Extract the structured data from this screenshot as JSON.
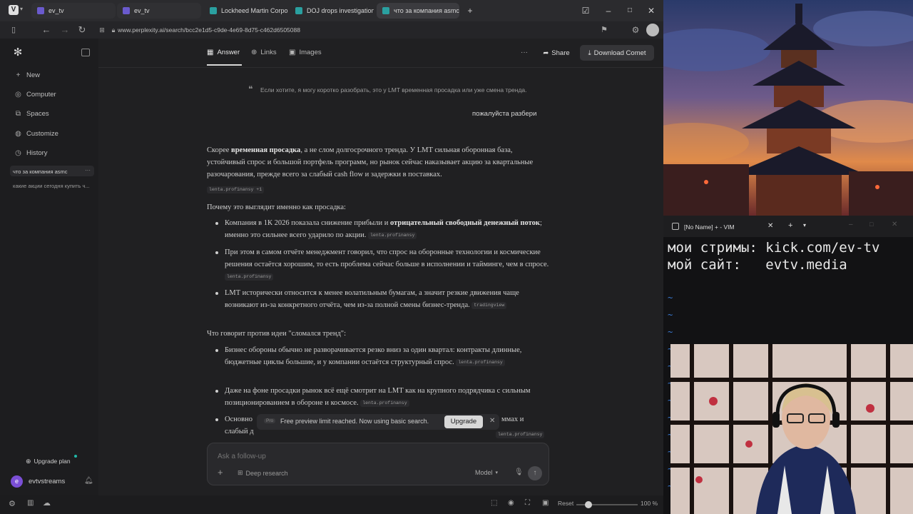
{
  "tabs": [
    {
      "label": "ev_tv",
      "color": "#6a5acd"
    },
    {
      "label": "ev_tv",
      "color": "#6a5acd"
    },
    {
      "label": "Lockheed Martin Corporat",
      "color": "#2aa0a0"
    },
    {
      "label": "DOJ drops investigation of",
      "color": "#2aa0a0"
    },
    {
      "label": "что за компания asmc",
      "color": "#2aa0a0"
    }
  ],
  "url": "www.perplexity.ai/search/bcc2e1d5-c9de-4e69-8d75-c462d6505088",
  "sidebar": {
    "items": [
      {
        "label": "New",
        "icon": "plus-icon"
      },
      {
        "label": "Computer",
        "icon": "computer-icon"
      },
      {
        "label": "Spaces",
        "icon": "spaces-icon"
      },
      {
        "label": "Customize",
        "icon": "customize-icon"
      },
      {
        "label": "History",
        "icon": "history-icon"
      }
    ],
    "threads": [
      "что за компания asmc",
      "какие акции сегодня купить ч..."
    ],
    "upgrade_label": "Upgrade plan",
    "user_name": "evtvstreams",
    "user_initial": "e"
  },
  "content_tabs": [
    {
      "label": "Answer",
      "icon": "answer-icon"
    },
    {
      "label": "Links",
      "icon": "globe-icon"
    },
    {
      "label": "Images",
      "icon": "image-icon"
    }
  ],
  "header": {
    "more_label": "···",
    "share_label": "Share",
    "download_label": "Download Comet"
  },
  "quote_text": "Если хотите, я могу коротко разобрать, это у LMT временная просадка или уже смена тренда.",
  "user_message": "пожалуйста разбери",
  "answer": {
    "intro_pre": "Скорее ",
    "intro_bold": "временная просадка",
    "intro_rest": ", а не слом долгосрочного тренда. У LMT сильная оборонная база, устойчивый спрос и большой портфель программ, но рынок сейчас наказывает акцию за квартальные разочарования, прежде всего за слабый cash flow и задержки в поставках.",
    "intro_src": "lenta.profinansy +1",
    "heading1": "Почему это выглядит именно как просадка:",
    "b1_pre": "Компания в 1К 2026 показала снижение прибыли и ",
    "b1_bold": "отрицательный свободный денежный поток",
    "b1_rest": "; именно это сильнее всего ударило по акции.",
    "b1_src": "lenta.profinansy",
    "b2_text": "При этом в самом отчёте менеджмент говорил, что спрос на оборонные технологии и космические решения остаётся хорошим, то есть проблема сейчас больше в исполнении и тайминге, чем в спросе.",
    "b2_src": "lenta.profinansy",
    "b3_text": "LMT исторически относится к менее волатильным бумагам, а значит резкие движения чаще возникают из-за конкретного отчёта, чем из-за полной смены бизнес-тренда.",
    "b3_src": "tradingview",
    "heading2": "Что говорит против идеи \"сломался тренд\":",
    "b4_text": "Бизнес обороны обычно не разворачивается резко вниз за один квартал: контракты длинные, бюджетные циклы большие, и у компании остаётся структурный спрос.",
    "b4_src": "lenta.profinansy",
    "b5_text": "Даже на фоне просадки рынок всё ещё смотрит на LMT как на крупного подрядчика с сильным позиционированием в обороне и космосе.",
    "b5_src": "lenta.profinansy",
    "b6_start": "Основно",
    "b6_end": "ммах и",
    "b6_line2": "слабый д",
    "b6_src": "lenta.profinansy"
  },
  "limit_bar": {
    "badge": "Pro",
    "text": "Free preview limit reached. Now using basic search.",
    "button": "Upgrade"
  },
  "followup": {
    "placeholder": "Ask a follow-up",
    "deep_research": "Deep research",
    "model": "Model"
  },
  "statusbar": {
    "reset": "Reset",
    "zoom": "100 %"
  },
  "vim": {
    "title": "[No Name] + - VIM",
    "line1": "мои стримы: kick.com/ev-tv",
    "line2": "мой сайт:   evtv.media",
    "tilde": "~"
  }
}
